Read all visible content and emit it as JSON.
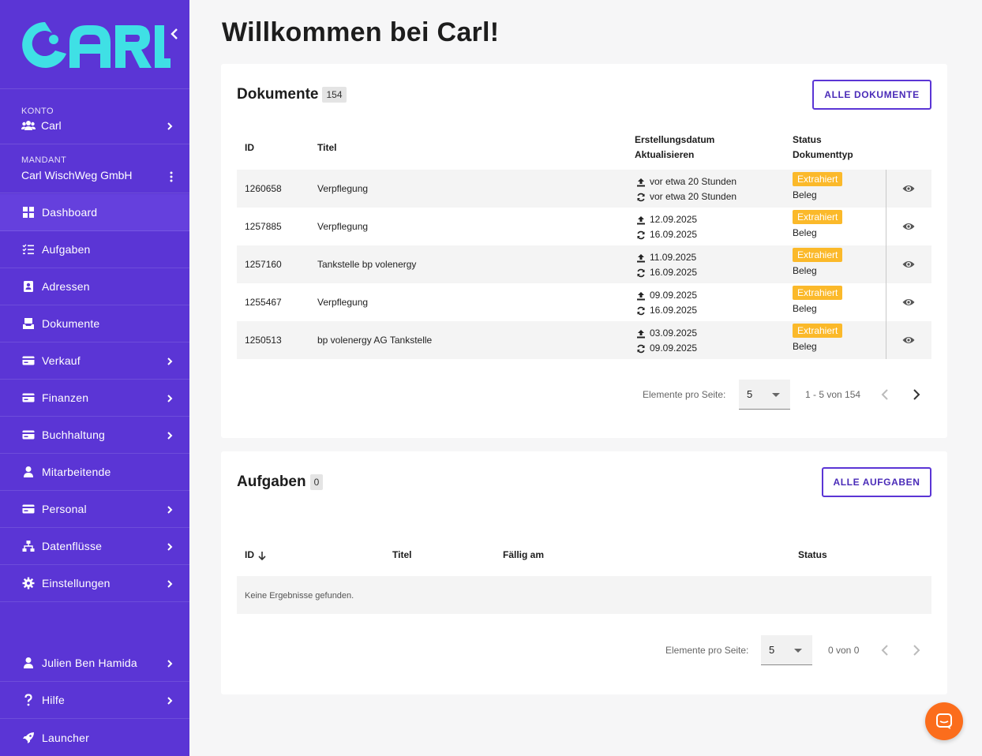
{
  "app": {
    "logo_text": "CARL",
    "colors": {
      "sidebar": "#5b35d5",
      "logo": "#3fe0e5",
      "badge": "#fbb92a",
      "chat": "#fb6d1c"
    }
  },
  "sidebar": {
    "account": {
      "label": "KONTO",
      "value": "Carl",
      "icon": "users-icon"
    },
    "tenant": {
      "label": "MANDANT",
      "value": "Carl WischWeg GmbH"
    },
    "nav": [
      {
        "label": "Dashboard",
        "icon": "dashboard-icon",
        "active": true,
        "has_children": false
      },
      {
        "label": "Aufgaben",
        "icon": "tasks-icon",
        "has_children": false
      },
      {
        "label": "Adressen",
        "icon": "address-book-icon",
        "has_children": false
      },
      {
        "label": "Dokumente",
        "icon": "inbox-icon",
        "has_children": false
      },
      {
        "label": "Verkauf",
        "icon": "card-icon",
        "has_children": true
      },
      {
        "label": "Finanzen",
        "icon": "card-icon",
        "has_children": true
      },
      {
        "label": "Buchhaltung",
        "icon": "card-icon",
        "has_children": true
      },
      {
        "label": "Mitarbeitende",
        "icon": "user-icon",
        "has_children": false
      },
      {
        "label": "Personal",
        "icon": "card-icon",
        "has_children": true
      },
      {
        "label": "Datenflüsse",
        "icon": "sitemap-icon",
        "has_children": true
      },
      {
        "label": "Einstellungen",
        "icon": "gear-icon",
        "has_children": true
      }
    ],
    "bottom": [
      {
        "label": "Julien Ben Hamida",
        "icon": "user-icon",
        "has_children": true
      },
      {
        "label": "Hilfe",
        "icon": "question-icon",
        "has_children": true
      },
      {
        "label": "Launcher",
        "icon": "rocket-icon",
        "has_children": false
      }
    ]
  },
  "main": {
    "title": "Willkommen bei Carl!",
    "documents": {
      "title": "Dokumente",
      "count": "154",
      "button": "ALLE DOKUMENTE",
      "headers": {
        "id": "ID",
        "title": "Titel",
        "created": "Erstellungsdatum",
        "updated": "Aktualisieren",
        "status": "Status",
        "doctype": "Dokumenttyp"
      },
      "rows": [
        {
          "id": "1260658",
          "title": "Verpflegung",
          "created": "vor etwa 20 Stunden",
          "updated": "vor etwa 20 Stunden",
          "status": "Extrahiert",
          "doctype": "Beleg"
        },
        {
          "id": "1257885",
          "title": "Verpflegung",
          "created": "12.09.2025",
          "updated": "16.09.2025",
          "status": "Extrahiert",
          "doctype": "Beleg"
        },
        {
          "id": "1257160",
          "title": "Tankstelle bp volenergy",
          "created": "11.09.2025",
          "updated": "16.09.2025",
          "status": "Extrahiert",
          "doctype": "Beleg"
        },
        {
          "id": "1255467",
          "title": "Verpflegung",
          "created": "09.09.2025",
          "updated": "16.09.2025",
          "status": "Extrahiert",
          "doctype": "Beleg"
        },
        {
          "id": "1250513",
          "title": "bp volenergy AG Tankstelle",
          "created": "03.09.2025",
          "updated": "09.09.2025",
          "status": "Extrahiert",
          "doctype": "Beleg"
        }
      ],
      "pager": {
        "label": "Elemente pro Seite:",
        "per_page": "5",
        "range": "1 - 5 von 154"
      }
    },
    "tasks": {
      "title": "Aufgaben",
      "count": "0",
      "button": "ALLE AUFGABEN",
      "headers": {
        "id": "ID",
        "title": "Titel",
        "due": "Fällig am",
        "status": "Status"
      },
      "empty": "Keine Ergebnisse gefunden.",
      "pager": {
        "label": "Elemente pro Seite:",
        "per_page": "5",
        "range": "0 von 0"
      }
    }
  }
}
